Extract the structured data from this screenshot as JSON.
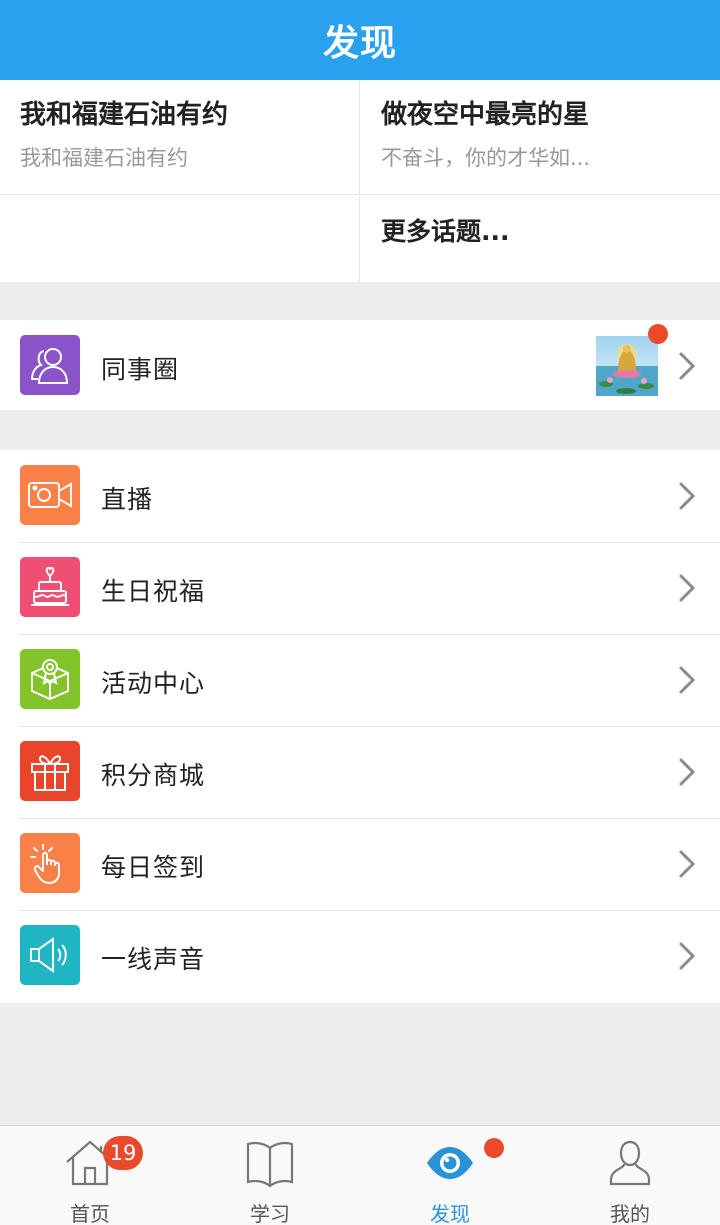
{
  "header": {
    "title": "发现"
  },
  "topics": [
    {
      "title": "我和福建石油有约",
      "subtitle": "我和福建石油有约"
    },
    {
      "title": "做夜空中最亮的星",
      "subtitle": "不奋斗，你的才华如..."
    }
  ],
  "topics_more": "更多话题...",
  "moments": {
    "label": "同事圈",
    "icon": "people-icon",
    "color": "#8a54c8",
    "has_new": true
  },
  "menu": [
    {
      "label": "直播",
      "icon": "video-camera-icon",
      "color": "#f98147"
    },
    {
      "label": "生日祝福",
      "icon": "cake-icon",
      "color": "#ef4f72"
    },
    {
      "label": "活动中心",
      "icon": "award-box-icon",
      "color": "#84c42b"
    },
    {
      "label": "积分商城",
      "icon": "gift-icon",
      "color": "#e9452d"
    },
    {
      "label": "每日签到",
      "icon": "tap-hand-icon",
      "color": "#f98147"
    },
    {
      "label": "一线声音",
      "icon": "megaphone-icon",
      "color": "#1fb5c2"
    }
  ],
  "tabbar": {
    "tabs": [
      {
        "label": "首页",
        "icon": "home-icon",
        "badge": "19"
      },
      {
        "label": "学习",
        "icon": "book-icon"
      },
      {
        "label": "发现",
        "icon": "eye-icon",
        "active": true,
        "dot": true
      },
      {
        "label": "我的",
        "icon": "person-icon"
      }
    ]
  },
  "colors": {
    "primary": "#2aa1ee",
    "badge": "#e84a2b",
    "active_tab": "#2a93d8"
  }
}
